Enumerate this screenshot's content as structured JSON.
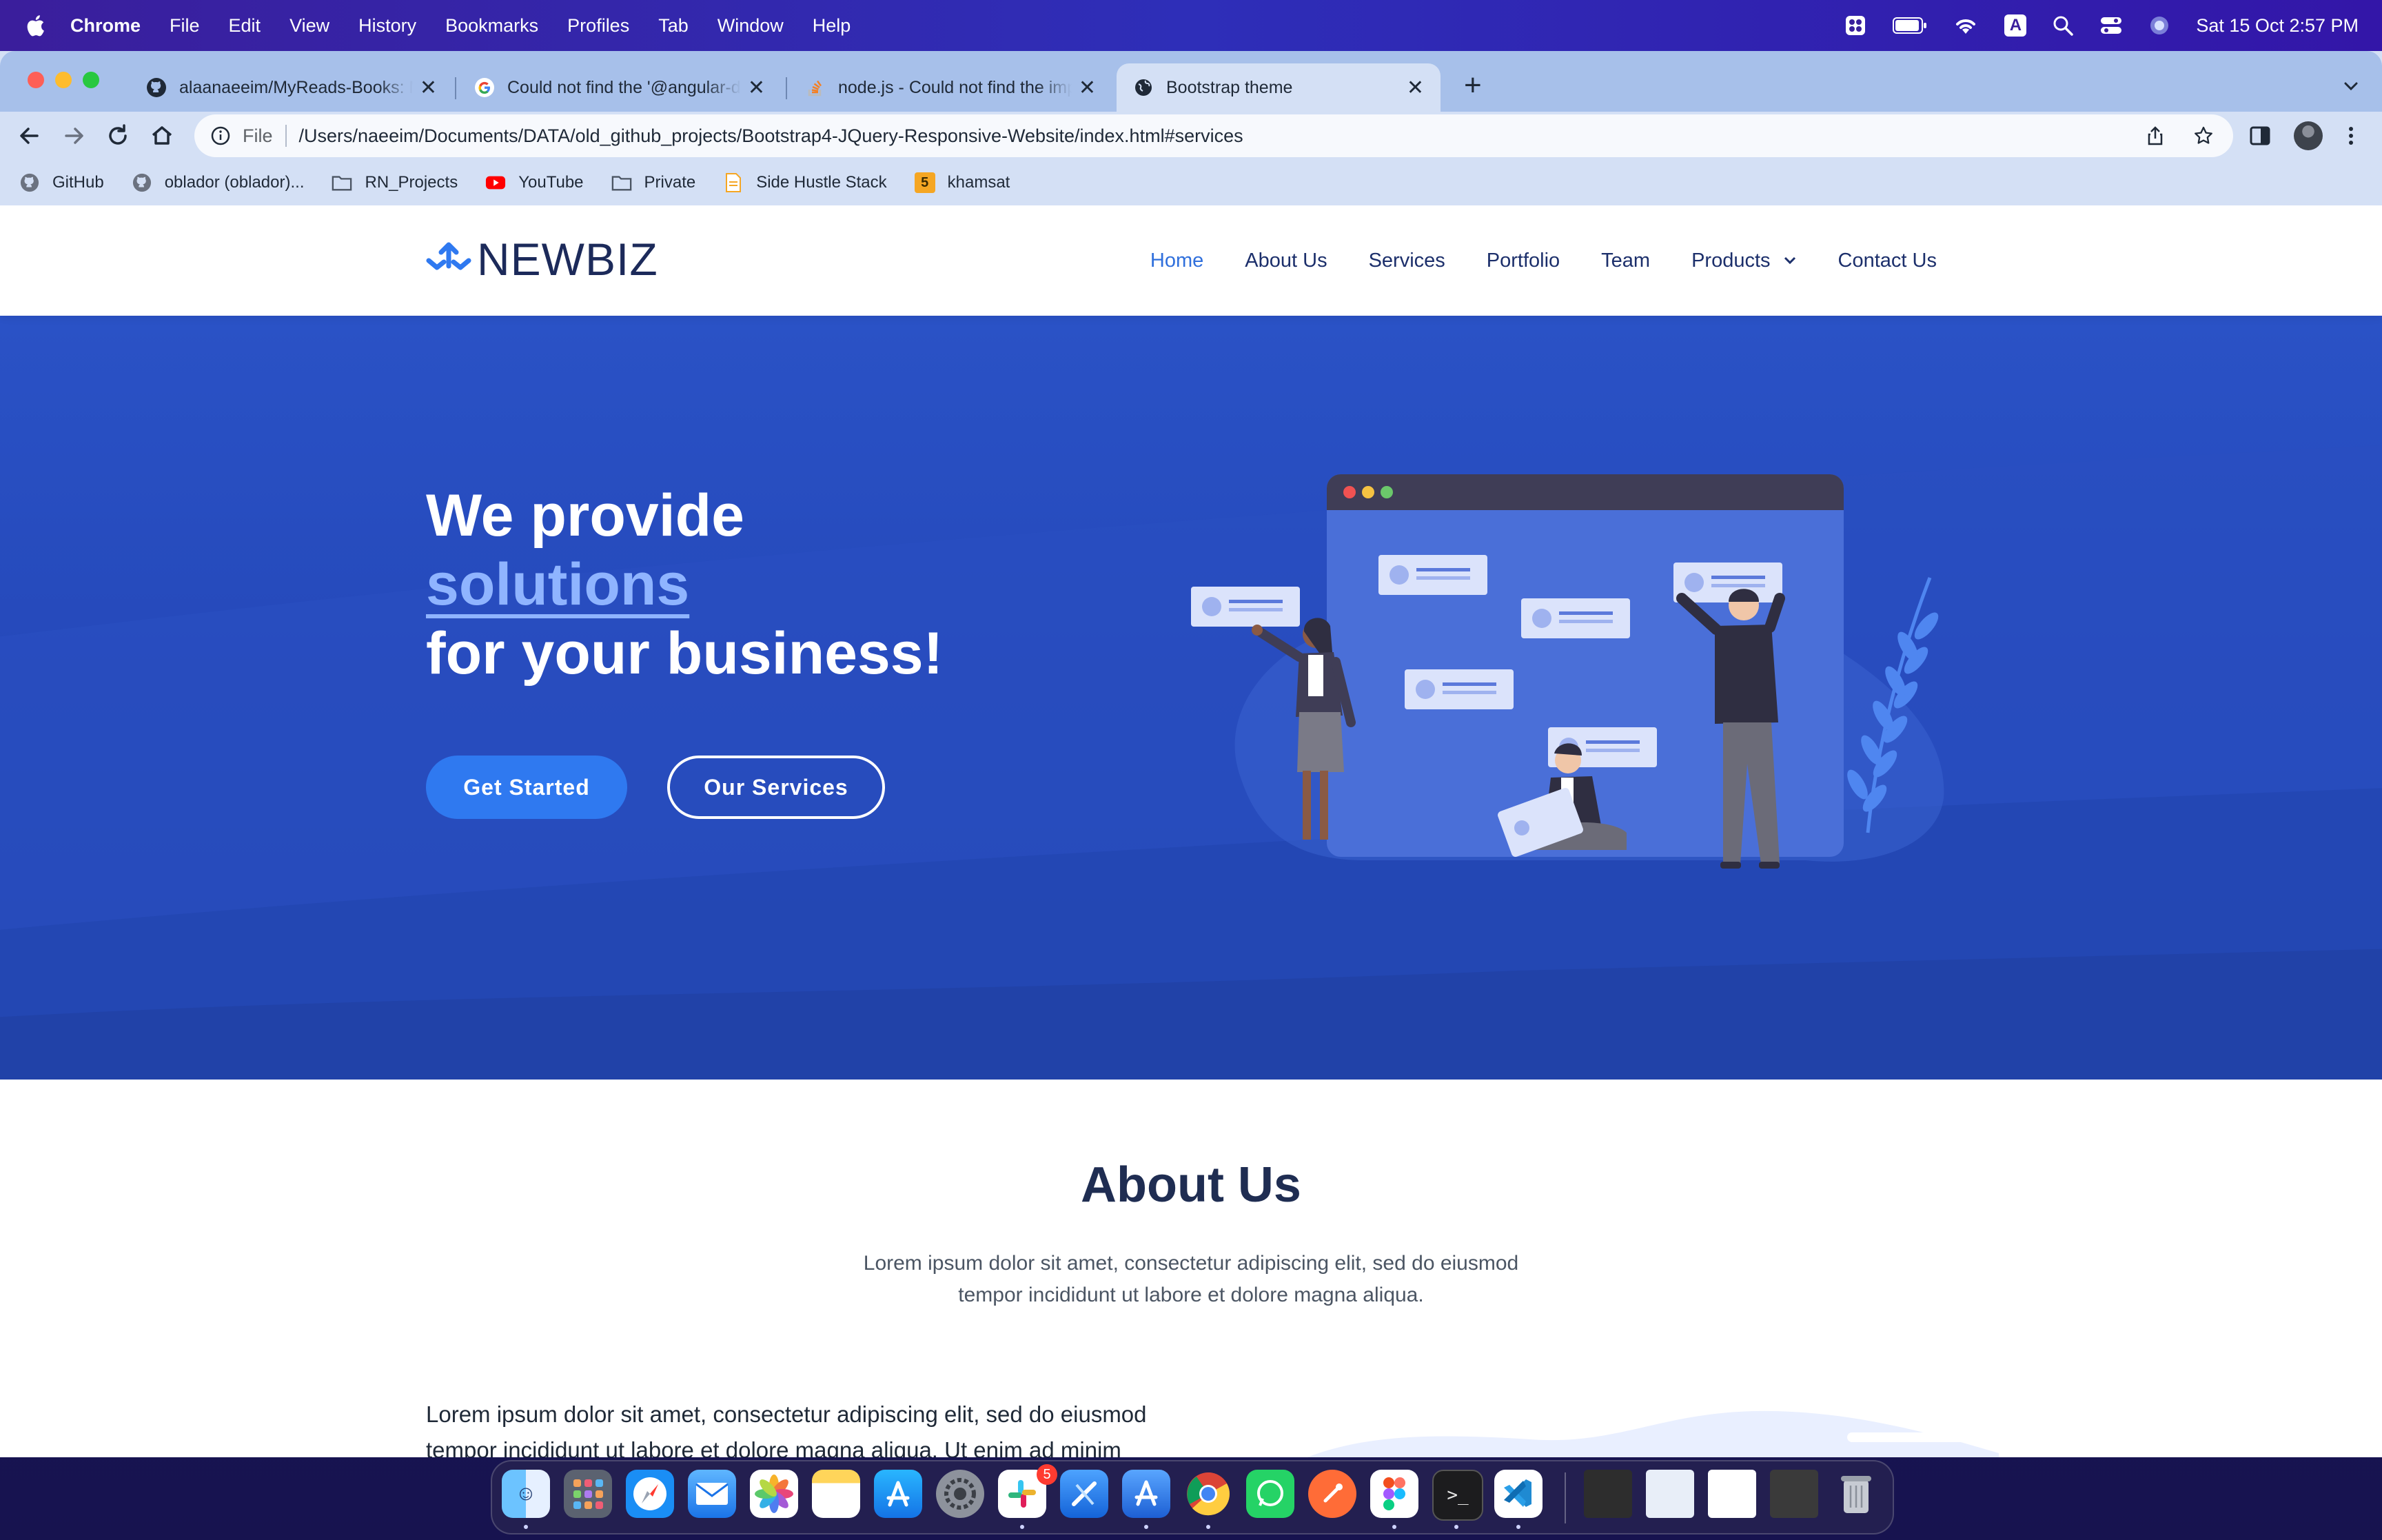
{
  "menubar": {
    "app_name": "Chrome",
    "menus": [
      "File",
      "Edit",
      "View",
      "History",
      "Bookmarks",
      "Profiles",
      "Tab",
      "Window",
      "Help"
    ],
    "clock": "Sat 15 Oct  2:57 PM",
    "input_source": "A"
  },
  "browser": {
    "tabs": [
      {
        "title": "alaanaeeim/MyReads-Books: M",
        "icon": "github-icon"
      },
      {
        "title": "Could not find the '@angular-d",
        "icon": "google-icon"
      },
      {
        "title": "node.js - Could not find the imp",
        "icon": "stackoverflow-icon"
      },
      {
        "title": "Bootstrap theme",
        "icon": "globe-icon"
      }
    ],
    "omnibox": {
      "scheme_label": "File",
      "url": "/Users/naeeim/Documents/DATA/old_github_projects/Bootstrap4-JQuery-Responsive-Website/index.html#services"
    },
    "bookmarks": [
      {
        "label": "GitHub",
        "icon": "github-icon"
      },
      {
        "label": "oblador (oblador)...",
        "icon": "github-icon"
      },
      {
        "label": "RN_Projects",
        "icon": "folder-icon"
      },
      {
        "label": "YouTube",
        "icon": "youtube-icon"
      },
      {
        "label": "Private",
        "icon": "folder-icon"
      },
      {
        "label": "Side Hustle Stack",
        "icon": "doc-icon"
      },
      {
        "label": "khamsat",
        "icon": "khamsat-icon",
        "badge": "5"
      }
    ]
  },
  "site": {
    "logo_text": "NEWBIZ",
    "nav": [
      "Home",
      "About Us",
      "Services",
      "Portfolio",
      "Team",
      "Products",
      "Contact Us"
    ],
    "hero": {
      "line1": "We provide",
      "line2": "solutions",
      "line3": "for your business!",
      "cta_primary": "Get Started",
      "cta_secondary": "Our Services"
    },
    "about": {
      "title": "About Us",
      "subtitle": "Lorem ipsum dolor sit amet, consectetur adipiscing elit, sed do eiusmod tempor incididunt ut labore et dolore magna aliqua.",
      "body": "Lorem ipsum dolor sit amet, consectetur adipiscing elit, sed do eiusmod tempor incididunt ut labore et dolore magna aliqua. Ut enim ad minim"
    }
  },
  "dock": {
    "apps": [
      "Finder",
      "Launchpad",
      "Safari",
      "Mail",
      "Photos",
      "Notes",
      "App Store",
      "System Preferences",
      "Slack",
      "Xcode",
      "Simulator",
      "Chrome",
      "WhatsApp",
      "Postman",
      "Figma",
      "Terminal",
      "VS Code"
    ],
    "slack_badge": "5"
  },
  "colors": {
    "hero_bg": "#2447b8",
    "accent": "#2f79f0",
    "nav_active": "#2f6fdc",
    "nav_text": "#1c2f6b"
  }
}
